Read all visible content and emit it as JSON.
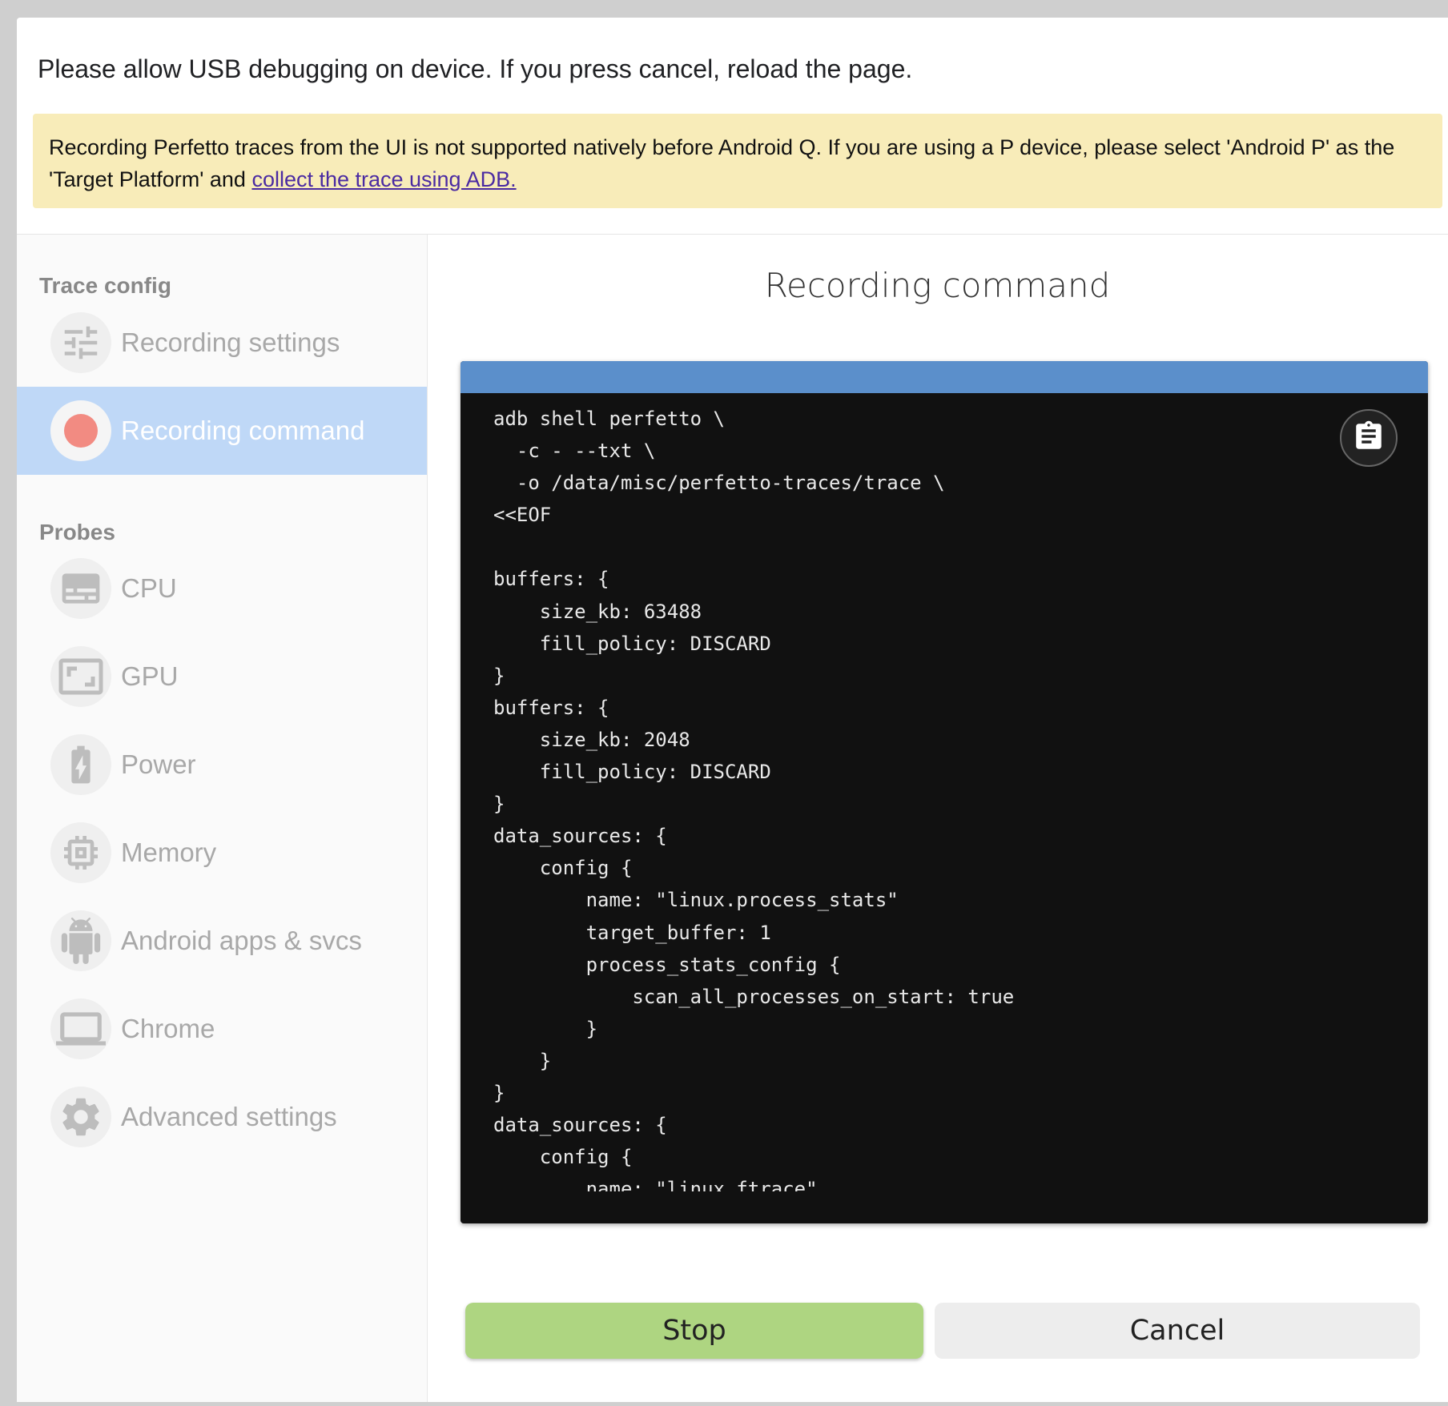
{
  "usb_message": "Please allow USB debugging on device. If you press cancel, reload the page.",
  "warning": {
    "text": "Recording Perfetto traces from the UI is not supported natively before Android Q. If you are using a P device, please select 'Android P' as the 'Target Platform' and ",
    "link": "collect the trace using ADB."
  },
  "sidebar": {
    "trace_config_title": "Trace config",
    "probes_title": "Probes",
    "items": [
      {
        "label": "Recording settings",
        "icon": "tune-icon"
      },
      {
        "label": "Recording command",
        "icon": "record-icon",
        "active": true
      },
      {
        "label": "CPU",
        "icon": "cpu-icon"
      },
      {
        "label": "GPU",
        "icon": "gpu-icon"
      },
      {
        "label": "Power",
        "icon": "battery-icon"
      },
      {
        "label": "Memory",
        "icon": "memory-icon"
      },
      {
        "label": "Android apps & svcs",
        "icon": "android-icon"
      },
      {
        "label": "Chrome",
        "icon": "laptop-icon"
      },
      {
        "label": "Advanced settings",
        "icon": "settings-icon"
      }
    ]
  },
  "main": {
    "title": "Recording command",
    "command": "adb shell perfetto \\\n  -c - --txt \\\n  -o /data/misc/perfetto-traces/trace \\\n<<EOF\n\nbuffers: {\n    size_kb: 63488\n    fill_policy: DISCARD\n}\nbuffers: {\n    size_kb: 2048\n    fill_policy: DISCARD\n}\ndata_sources: {\n    config {\n        name: \"linux.process_stats\"\n        target_buffer: 1\n        process_stats_config {\n            scan_all_processes_on_start: true\n        }\n    }\n}\ndata_sources: {\n    config {\n        name: \"linux.ftrace\"\n        ftrace_config {",
    "copy_icon": "clipboard-icon"
  },
  "buttons": {
    "stop": "Stop",
    "cancel": "Cancel"
  },
  "colors": {
    "accent_active": "#bfd8f7",
    "code_header": "#5b8fcb",
    "warning_bg": "#f8ecb9",
    "stop_button": "#aed581",
    "record_dot": "#f28b82"
  }
}
